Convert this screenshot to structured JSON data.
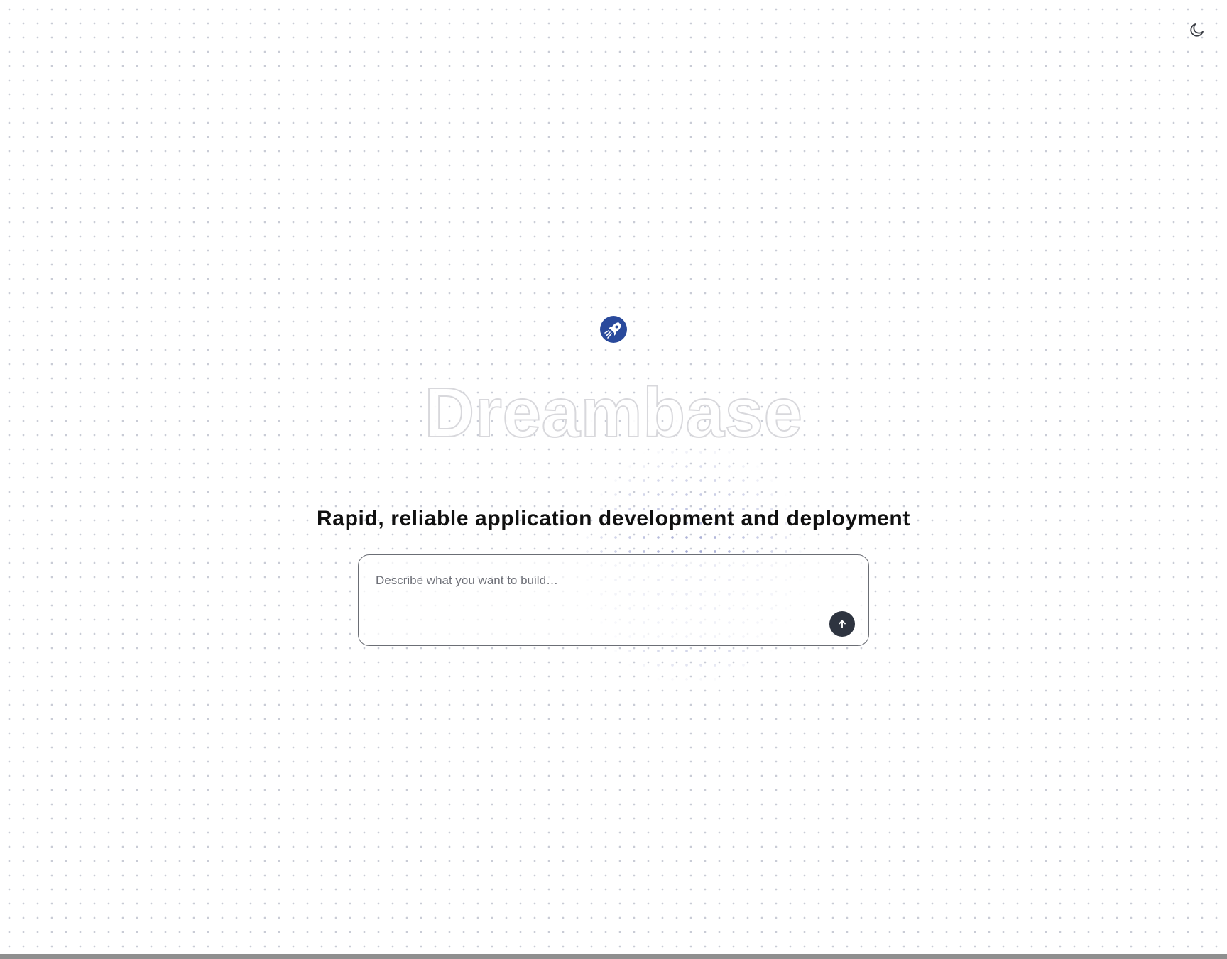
{
  "header": {
    "theme_toggle_icon": "moon-icon"
  },
  "hero": {
    "logo_icon": "rocket-icon",
    "logo_color": "#2a4a9c",
    "wordmark": "Dreambase",
    "tagline": "Rapid, reliable application development and deployment"
  },
  "composer": {
    "value": "",
    "placeholder": "Describe what you want to build…",
    "send_icon": "arrow-up-icon",
    "send_button_color": "#2e3440"
  },
  "colors": {
    "background": "#ffffff",
    "dot_grid": "#c9ccd6",
    "dot_glow": "#8f97c9",
    "wordmark_outline": "#d8d8dc",
    "tagline": "#101010"
  }
}
